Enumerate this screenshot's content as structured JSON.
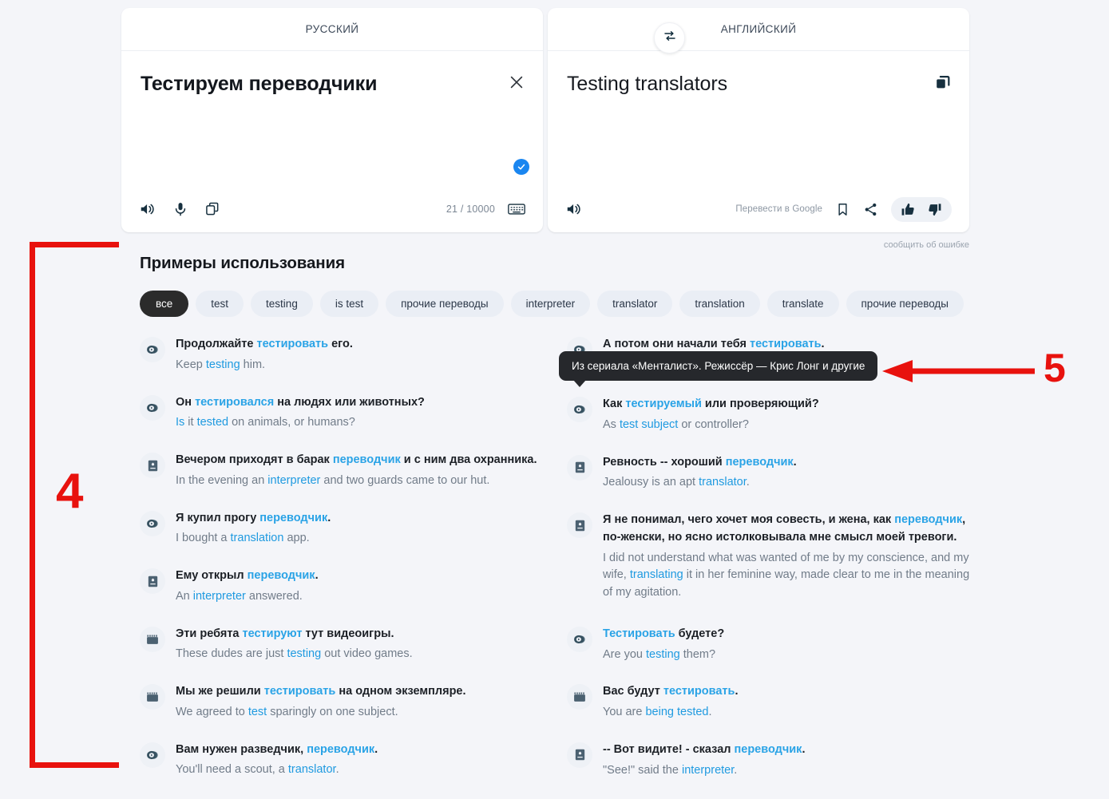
{
  "source_panel": {
    "language": "РУССКИЙ",
    "text": "Тестируем переводчики",
    "char_count": "21 / 10000",
    "icons": {
      "listen": "speaker-icon",
      "mic": "microphone-icon",
      "copy": "copy-icon",
      "keyboard": "keyboard-icon",
      "clear": "close-icon",
      "verified": "verified-check-icon"
    }
  },
  "target_panel": {
    "language": "АНГЛИЙСКИЙ",
    "text": "Testing translators",
    "google_link": "Перевести в Google",
    "icons": {
      "listen": "speaker-icon",
      "copy": "copy-icon",
      "bookmark": "bookmark-icon",
      "share": "share-icon",
      "thumbs_up": "thumb-up-icon",
      "thumbs_down": "thumb-down-icon"
    }
  },
  "swap_button_icon": "swap-arrows-icon",
  "report_error": "сообщить об ошибке",
  "examples": {
    "title": "Примеры использования",
    "chips": [
      {
        "label": "все",
        "active": true
      },
      {
        "label": "test",
        "active": false
      },
      {
        "label": "testing",
        "active": false
      },
      {
        "label": "is test",
        "active": false
      },
      {
        "label": "прочие переводы",
        "active": false
      },
      {
        "label": "interpreter",
        "active": false
      },
      {
        "label": "translator",
        "active": false
      },
      {
        "label": "translation",
        "active": false
      },
      {
        "label": "translate",
        "active": false
      },
      {
        "label": "прочие переводы",
        "active": false
      }
    ],
    "left_column": [
      {
        "icon": "video-play-icon",
        "src_pre": "Продолжайте ",
        "src_hl": "тестировать",
        "src_post": " его.",
        "tgt_pre": "Keep ",
        "tgt_hl": "testing",
        "tgt_post": " him."
      },
      {
        "icon": "video-play-icon",
        "src_pre": "Он ",
        "src_hl": "тестировался",
        "src_post": " на людях или животных?",
        "tgt_pre": "",
        "tgt_hl": "Is",
        "tgt_mid": " it ",
        "tgt_hl2": "tested",
        "tgt_post": " on animals, or humans?"
      },
      {
        "icon": "book-icon",
        "src_pre": "Вечером приходят в барак ",
        "src_hl": "переводчик",
        "src_post": " и с ним два охранника.",
        "tgt_pre": "In the evening an ",
        "tgt_hl": "interpreter",
        "tgt_post": " and two guards came to our hut."
      },
      {
        "icon": "video-play-icon",
        "src_pre": "Я купил прогу ",
        "src_hl": "переводчик",
        "src_post": ".",
        "tgt_pre": "I bought a ",
        "tgt_hl": "translation",
        "tgt_post": " app."
      },
      {
        "icon": "book-icon",
        "src_pre": "Ему открыл ",
        "src_hl": "переводчик",
        "src_post": ".",
        "tgt_pre": "An ",
        "tgt_hl": "interpreter",
        "tgt_post": " answered."
      },
      {
        "icon": "film-clapper-icon",
        "src_pre": "Эти ребята ",
        "src_hl": "тестируют",
        "src_post": " тут видеоигры.",
        "tgt_pre": "These dudes are just ",
        "tgt_hl": "testing",
        "tgt_post": " out video games."
      },
      {
        "icon": "film-clapper-icon",
        "src_pre": "Мы же решили ",
        "src_hl": "тестировать",
        "src_post": " на одном экземпляре.",
        "tgt_pre": "We agreed to ",
        "tgt_hl": "test",
        "tgt_post": " sparingly on one subject."
      },
      {
        "icon": "video-play-icon",
        "src_pre": "Вам нужен разведчик, ",
        "src_hl": "переводчик",
        "src_post": ".",
        "tgt_pre": "You'll need a scout, a ",
        "tgt_hl": "translator",
        "tgt_post": "."
      }
    ],
    "right_column": [
      {
        "icon": "video-play-icon",
        "src_pre": "А потом они начали тебя ",
        "src_hl": "тестировать",
        "src_post": ".",
        "tgt_pre": "",
        "tgt_hl": "",
        "tgt_post": ""
      },
      {
        "icon": "video-play-icon",
        "src_pre": "Как ",
        "src_hl": "тестируемый",
        "src_post": " или проверяющий?",
        "tgt_pre": "As ",
        "tgt_hl": "test subject",
        "tgt_post": " or controller?"
      },
      {
        "icon": "book-icon",
        "src_pre": "Ревность -- хороший ",
        "src_hl": "переводчик",
        "src_post": ".",
        "tgt_pre": "Jealousy is an apt ",
        "tgt_hl": "translator",
        "tgt_post": "."
      },
      {
        "icon": "book-icon",
        "src_pre": "Я не понимал, чего хочет моя совесть, и жена, как ",
        "src_hl": "переводчик",
        "src_post": ", по-женски, но ясно истолковывала мне смысл моей тревоги.",
        "tgt_pre": "I did not understand what was wanted of me by my conscience, and my wife, ",
        "tgt_hl": "translating",
        "tgt_post": " it in her feminine way, made clear to me in the meaning of my agitation."
      },
      {
        "icon": "video-play-icon",
        "src_pre": "",
        "src_hl": "Тестировать",
        "src_post": " будете?",
        "tgt_pre": "Are you ",
        "tgt_hl": "testing",
        "tgt_post": " them?"
      },
      {
        "icon": "film-clapper-icon",
        "src_pre": "Вас будут ",
        "src_hl": "тестировать",
        "src_post": ".",
        "tgt_pre": "You are ",
        "tgt_hl": "being tested",
        "tgt_post": "."
      },
      {
        "icon": "book-icon",
        "src_pre": "-- Вот видите! - сказал ",
        "src_hl": "переводчик",
        "src_post": ".",
        "tgt_pre": "\"See!\" said the ",
        "tgt_hl": "interpreter",
        "tgt_post": "."
      }
    ]
  },
  "tooltip": {
    "text": "Из сериала «Менталист». Режиссёр — Крис Лонг и другие"
  },
  "annotations": {
    "label_4": "4",
    "label_5": "5",
    "color": "#e8120e"
  }
}
